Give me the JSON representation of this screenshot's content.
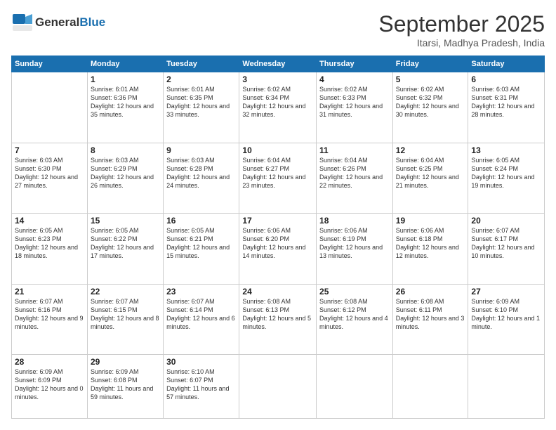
{
  "logo": {
    "line1": "General",
    "line2": "Blue"
  },
  "title": "September 2025",
  "location": "Itarsi, Madhya Pradesh, India",
  "days_header": [
    "Sunday",
    "Monday",
    "Tuesday",
    "Wednesday",
    "Thursday",
    "Friday",
    "Saturday"
  ],
  "weeks": [
    [
      {
        "day": "",
        "info": ""
      },
      {
        "day": "1",
        "info": "Sunrise: 6:01 AM\nSunset: 6:36 PM\nDaylight: 12 hours\nand 35 minutes."
      },
      {
        "day": "2",
        "info": "Sunrise: 6:01 AM\nSunset: 6:35 PM\nDaylight: 12 hours\nand 33 minutes."
      },
      {
        "day": "3",
        "info": "Sunrise: 6:02 AM\nSunset: 6:34 PM\nDaylight: 12 hours\nand 32 minutes."
      },
      {
        "day": "4",
        "info": "Sunrise: 6:02 AM\nSunset: 6:33 PM\nDaylight: 12 hours\nand 31 minutes."
      },
      {
        "day": "5",
        "info": "Sunrise: 6:02 AM\nSunset: 6:32 PM\nDaylight: 12 hours\nand 30 minutes."
      },
      {
        "day": "6",
        "info": "Sunrise: 6:03 AM\nSunset: 6:31 PM\nDaylight: 12 hours\nand 28 minutes."
      }
    ],
    [
      {
        "day": "7",
        "info": "Sunrise: 6:03 AM\nSunset: 6:30 PM\nDaylight: 12 hours\nand 27 minutes."
      },
      {
        "day": "8",
        "info": "Sunrise: 6:03 AM\nSunset: 6:29 PM\nDaylight: 12 hours\nand 26 minutes."
      },
      {
        "day": "9",
        "info": "Sunrise: 6:03 AM\nSunset: 6:28 PM\nDaylight: 12 hours\nand 24 minutes."
      },
      {
        "day": "10",
        "info": "Sunrise: 6:04 AM\nSunset: 6:27 PM\nDaylight: 12 hours\nand 23 minutes."
      },
      {
        "day": "11",
        "info": "Sunrise: 6:04 AM\nSunset: 6:26 PM\nDaylight: 12 hours\nand 22 minutes."
      },
      {
        "day": "12",
        "info": "Sunrise: 6:04 AM\nSunset: 6:25 PM\nDaylight: 12 hours\nand 21 minutes."
      },
      {
        "day": "13",
        "info": "Sunrise: 6:05 AM\nSunset: 6:24 PM\nDaylight: 12 hours\nand 19 minutes."
      }
    ],
    [
      {
        "day": "14",
        "info": "Sunrise: 6:05 AM\nSunset: 6:23 PM\nDaylight: 12 hours\nand 18 minutes."
      },
      {
        "day": "15",
        "info": "Sunrise: 6:05 AM\nSunset: 6:22 PM\nDaylight: 12 hours\nand 17 minutes."
      },
      {
        "day": "16",
        "info": "Sunrise: 6:05 AM\nSunset: 6:21 PM\nDaylight: 12 hours\nand 15 minutes."
      },
      {
        "day": "17",
        "info": "Sunrise: 6:06 AM\nSunset: 6:20 PM\nDaylight: 12 hours\nand 14 minutes."
      },
      {
        "day": "18",
        "info": "Sunrise: 6:06 AM\nSunset: 6:19 PM\nDaylight: 12 hours\nand 13 minutes."
      },
      {
        "day": "19",
        "info": "Sunrise: 6:06 AM\nSunset: 6:18 PM\nDaylight: 12 hours\nand 12 minutes."
      },
      {
        "day": "20",
        "info": "Sunrise: 6:07 AM\nSunset: 6:17 PM\nDaylight: 12 hours\nand 10 minutes."
      }
    ],
    [
      {
        "day": "21",
        "info": "Sunrise: 6:07 AM\nSunset: 6:16 PM\nDaylight: 12 hours\nand 9 minutes."
      },
      {
        "day": "22",
        "info": "Sunrise: 6:07 AM\nSunset: 6:15 PM\nDaylight: 12 hours\nand 8 minutes."
      },
      {
        "day": "23",
        "info": "Sunrise: 6:07 AM\nSunset: 6:14 PM\nDaylight: 12 hours\nand 6 minutes."
      },
      {
        "day": "24",
        "info": "Sunrise: 6:08 AM\nSunset: 6:13 PM\nDaylight: 12 hours\nand 5 minutes."
      },
      {
        "day": "25",
        "info": "Sunrise: 6:08 AM\nSunset: 6:12 PM\nDaylight: 12 hours\nand 4 minutes."
      },
      {
        "day": "26",
        "info": "Sunrise: 6:08 AM\nSunset: 6:11 PM\nDaylight: 12 hours\nand 3 minutes."
      },
      {
        "day": "27",
        "info": "Sunrise: 6:09 AM\nSunset: 6:10 PM\nDaylight: 12 hours\nand 1 minute."
      }
    ],
    [
      {
        "day": "28",
        "info": "Sunrise: 6:09 AM\nSunset: 6:09 PM\nDaylight: 12 hours\nand 0 minutes."
      },
      {
        "day": "29",
        "info": "Sunrise: 6:09 AM\nSunset: 6:08 PM\nDaylight: 11 hours\nand 59 minutes."
      },
      {
        "day": "30",
        "info": "Sunrise: 6:10 AM\nSunset: 6:07 PM\nDaylight: 11 hours\nand 57 minutes."
      },
      {
        "day": "",
        "info": ""
      },
      {
        "day": "",
        "info": ""
      },
      {
        "day": "",
        "info": ""
      },
      {
        "day": "",
        "info": ""
      }
    ]
  ]
}
